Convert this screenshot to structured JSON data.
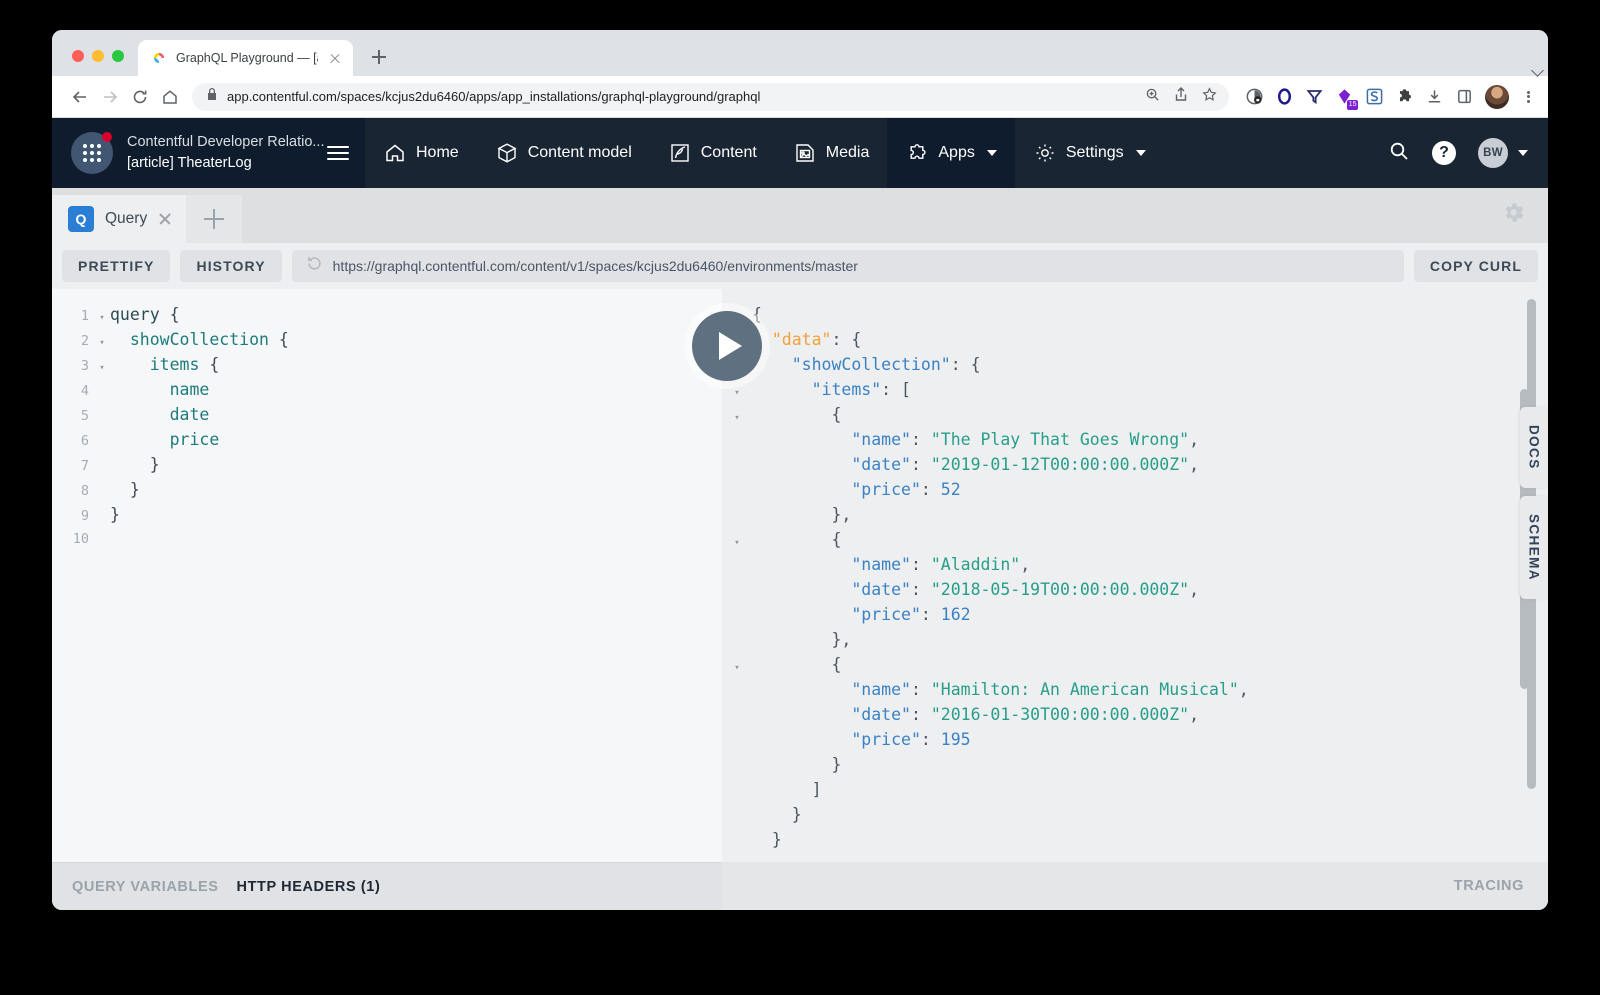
{
  "browser": {
    "tab_title": "GraphQL Playground — [article",
    "favicon": "contentful-c-icon",
    "new_tab_label": "+",
    "url": "app.contentful.com/spaces/kcjus2du6460/apps/app_installations/graphql-playground/graphql",
    "nav": {
      "back": "back-arrow",
      "forward": "forward-arrow",
      "reload": "reload-icon",
      "home": "home-icon"
    },
    "omnibox_icons": [
      "zoom-icon",
      "share-icon",
      "bookmark-star-icon"
    ],
    "extension_icons": [
      "shield-lock-icon",
      "opera-o-icon",
      "funnel-icon",
      "purple-gem-icon",
      "blue-s-icon",
      "puzzle-icon",
      "download-icon",
      "sidepanel-icon"
    ],
    "extension_badge": "15",
    "profile": "profile-avatar",
    "menu": "three-dot-menu"
  },
  "contentful": {
    "space_name": "Contentful Developer Relatio...",
    "environment": "[article] TheaterLog",
    "nav_items": [
      {
        "label": "Home",
        "icon": "home-icon",
        "active": false,
        "caret": false
      },
      {
        "label": "Content model",
        "icon": "content-model-icon",
        "active": false,
        "caret": false
      },
      {
        "label": "Content",
        "icon": "content-pen-icon",
        "active": false,
        "caret": false
      },
      {
        "label": "Media",
        "icon": "media-image-icon",
        "active": false,
        "caret": false
      },
      {
        "label": "Apps",
        "icon": "puzzle-icon",
        "active": true,
        "caret": true
      },
      {
        "label": "Settings",
        "icon": "gear-icon",
        "active": false,
        "caret": true
      }
    ],
    "search_icon": "search-icon",
    "help_label": "?",
    "avatar_initials": "BW"
  },
  "playground": {
    "tab": {
      "badge": "Q",
      "label": "Query",
      "close": "close-icon"
    },
    "add_tab": "add-tab-icon",
    "settings_icon": "gear-icon",
    "toolbar": {
      "prettify": "PRETTIFY",
      "history": "HISTORY",
      "endpoint": "https://graphql.contentful.com/content/v1/spaces/kcjus2du6460/environments/master",
      "endpoint_reload_icon": "reload-icon",
      "copy_curl": "COPY CURL"
    },
    "play_button": "execute-query-button",
    "editor": {
      "lines": [
        {
          "num": "1",
          "fold": "▾",
          "indent": 0,
          "tokens": [
            {
              "t": "query ",
              "c": "kw"
            },
            {
              "t": "{",
              "c": "brc"
            }
          ]
        },
        {
          "num": "2",
          "fold": "▾",
          "indent": 0,
          "tokens": [
            {
              "t": "  showCollection ",
              "c": "fld"
            },
            {
              "t": "{",
              "c": "brc"
            }
          ]
        },
        {
          "num": "3",
          "fold": "▾",
          "indent": 0,
          "tokens": [
            {
              "t": "    items ",
              "c": "fld"
            },
            {
              "t": "{",
              "c": "brc"
            }
          ]
        },
        {
          "num": "4",
          "fold": "",
          "indent": 0,
          "tokens": [
            {
              "t": "      name",
              "c": "fld"
            }
          ]
        },
        {
          "num": "5",
          "fold": "",
          "indent": 0,
          "tokens": [
            {
              "t": "      date",
              "c": "fld"
            }
          ]
        },
        {
          "num": "6",
          "fold": "",
          "indent": 0,
          "tokens": [
            {
              "t": "      price",
              "c": "fld"
            }
          ]
        },
        {
          "num": "7",
          "fold": "",
          "indent": 0,
          "tokens": [
            {
              "t": "    }",
              "c": "brc"
            }
          ]
        },
        {
          "num": "8",
          "fold": "",
          "indent": 0,
          "tokens": [
            {
              "t": "  }",
              "c": "brc"
            }
          ]
        },
        {
          "num": "9",
          "fold": "",
          "indent": 0,
          "tokens": [
            {
              "t": "}",
              "c": "brc"
            }
          ]
        },
        {
          "num": "10",
          "fold": "",
          "indent": 0,
          "tokens": []
        }
      ]
    },
    "bottom_tabs": [
      {
        "label": "QUERY VARIABLES",
        "active": false
      },
      {
        "label": "HTTP HEADERS (1)",
        "active": true
      }
    ],
    "tracing_label": "TRACING",
    "side_tabs": [
      "DOCS",
      "SCHEMA"
    ],
    "result": {
      "lines": [
        {
          "fold": "▾",
          "tokens": [
            {
              "t": "{",
              "c": "j-punct"
            }
          ]
        },
        {
          "fold": "▾",
          "tokens": [
            {
              "t": "  ",
              "c": "j-punct"
            },
            {
              "t": "\"data\"",
              "c": "j-root"
            },
            {
              "t": ": {",
              "c": "j-punct"
            }
          ]
        },
        {
          "fold": "▾",
          "tokens": [
            {
              "t": "    ",
              "c": "j-punct"
            },
            {
              "t": "\"showCollection\"",
              "c": "j-key"
            },
            {
              "t": ": {",
              "c": "j-punct"
            }
          ]
        },
        {
          "fold": "▾",
          "tokens": [
            {
              "t": "      ",
              "c": "j-punct"
            },
            {
              "t": "\"items\"",
              "c": "j-key"
            },
            {
              "t": ": [",
              "c": "j-punct"
            }
          ]
        },
        {
          "fold": "▾",
          "tokens": [
            {
              "t": "        {",
              "c": "j-punct"
            }
          ]
        },
        {
          "fold": "",
          "tokens": [
            {
              "t": "          ",
              "c": "j-punct"
            },
            {
              "t": "\"name\"",
              "c": "j-key"
            },
            {
              "t": ": ",
              "c": "j-punct"
            },
            {
              "t": "\"The Play That Goes Wrong\"",
              "c": "j-str"
            },
            {
              "t": ",",
              "c": "j-punct"
            }
          ]
        },
        {
          "fold": "",
          "tokens": [
            {
              "t": "          ",
              "c": "j-punct"
            },
            {
              "t": "\"date\"",
              "c": "j-key"
            },
            {
              "t": ": ",
              "c": "j-punct"
            },
            {
              "t": "\"2019-01-12T00:00:00.000Z\"",
              "c": "j-str"
            },
            {
              "t": ",",
              "c": "j-punct"
            }
          ]
        },
        {
          "fold": "",
          "tokens": [
            {
              "t": "          ",
              "c": "j-punct"
            },
            {
              "t": "\"price\"",
              "c": "j-key"
            },
            {
              "t": ": ",
              "c": "j-punct"
            },
            {
              "t": "52",
              "c": "j-num"
            }
          ]
        },
        {
          "fold": "",
          "tokens": [
            {
              "t": "        },",
              "c": "j-punct"
            }
          ]
        },
        {
          "fold": "▾",
          "tokens": [
            {
              "t": "        {",
              "c": "j-punct"
            }
          ]
        },
        {
          "fold": "",
          "tokens": [
            {
              "t": "          ",
              "c": "j-punct"
            },
            {
              "t": "\"name\"",
              "c": "j-key"
            },
            {
              "t": ": ",
              "c": "j-punct"
            },
            {
              "t": "\"Aladdin\"",
              "c": "j-str"
            },
            {
              "t": ",",
              "c": "j-punct"
            }
          ]
        },
        {
          "fold": "",
          "tokens": [
            {
              "t": "          ",
              "c": "j-punct"
            },
            {
              "t": "\"date\"",
              "c": "j-key"
            },
            {
              "t": ": ",
              "c": "j-punct"
            },
            {
              "t": "\"2018-05-19T00:00:00.000Z\"",
              "c": "j-str"
            },
            {
              "t": ",",
              "c": "j-punct"
            }
          ]
        },
        {
          "fold": "",
          "tokens": [
            {
              "t": "          ",
              "c": "j-punct"
            },
            {
              "t": "\"price\"",
              "c": "j-key"
            },
            {
              "t": ": ",
              "c": "j-punct"
            },
            {
              "t": "162",
              "c": "j-num"
            }
          ]
        },
        {
          "fold": "",
          "tokens": [
            {
              "t": "        },",
              "c": "j-punct"
            }
          ]
        },
        {
          "fold": "▾",
          "tokens": [
            {
              "t": "        {",
              "c": "j-punct"
            }
          ]
        },
        {
          "fold": "",
          "tokens": [
            {
              "t": "          ",
              "c": "j-punct"
            },
            {
              "t": "\"name\"",
              "c": "j-key"
            },
            {
              "t": ": ",
              "c": "j-punct"
            },
            {
              "t": "\"Hamilton: An American Musical\"",
              "c": "j-str"
            },
            {
              "t": ",",
              "c": "j-punct"
            }
          ]
        },
        {
          "fold": "",
          "tokens": [
            {
              "t": "          ",
              "c": "j-punct"
            },
            {
              "t": "\"date\"",
              "c": "j-key"
            },
            {
              "t": ": ",
              "c": "j-punct"
            },
            {
              "t": "\"2016-01-30T00:00:00.000Z\"",
              "c": "j-str"
            },
            {
              "t": ",",
              "c": "j-punct"
            }
          ]
        },
        {
          "fold": "",
          "tokens": [
            {
              "t": "          ",
              "c": "j-punct"
            },
            {
              "t": "\"price\"",
              "c": "j-key"
            },
            {
              "t": ": ",
              "c": "j-punct"
            },
            {
              "t": "195",
              "c": "j-num"
            }
          ]
        },
        {
          "fold": "",
          "tokens": [
            {
              "t": "        }",
              "c": "j-punct"
            }
          ]
        },
        {
          "fold": "",
          "tokens": [
            {
              "t": "      ]",
              "c": "j-punct"
            }
          ]
        },
        {
          "fold": "",
          "tokens": [
            {
              "t": "    }",
              "c": "j-punct"
            }
          ]
        },
        {
          "fold": "",
          "tokens": [
            {
              "t": "  }",
              "c": "j-punct"
            }
          ]
        }
      ]
    }
  },
  "colors": {
    "cf_header": "#192532",
    "cf_space": "#0f1c2d",
    "playground_bg": "#eeeff0",
    "accent_blue": "#2a7ed3",
    "json_key": "#3b82c4",
    "json_string": "#279e8a",
    "json_root": "#f2a13c"
  }
}
